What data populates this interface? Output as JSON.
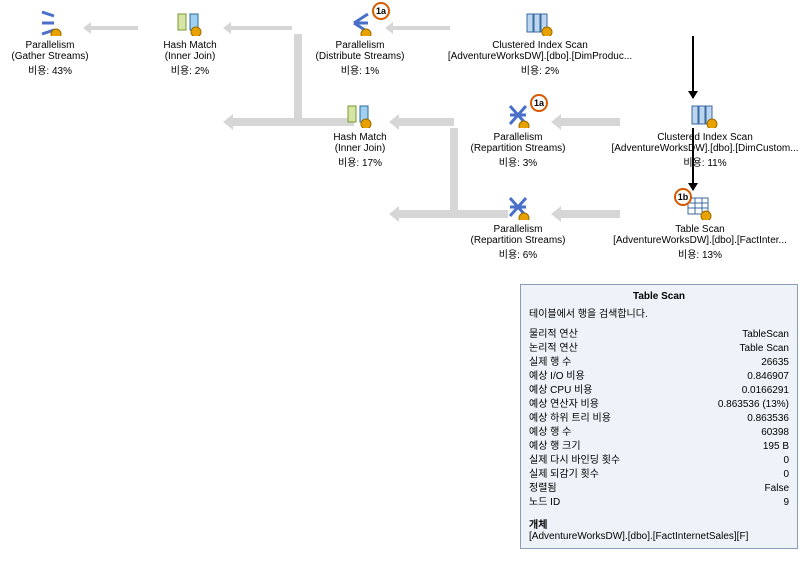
{
  "badges": {
    "a1": "1a",
    "a2": "1a",
    "b": "1b"
  },
  "nodes": {
    "gather": {
      "title": "Parallelism",
      "sub": "(Gather Streams)",
      "cost": "비용: 43%"
    },
    "hash1": {
      "title": "Hash Match",
      "sub": "(Inner Join)",
      "cost": "비용: 2%"
    },
    "dist": {
      "title": "Parallelism",
      "sub": "(Distribute Streams)",
      "cost": "비용: 1%"
    },
    "cis1": {
      "title": "Clustered Index Scan",
      "sub": "[AdventureWorksDW].[dbo].[DimProduc...",
      "cost": "비용: 2%"
    },
    "hash2": {
      "title": "Hash Match",
      "sub": "(Inner Join)",
      "cost": "비용: 17%"
    },
    "repart1": {
      "title": "Parallelism",
      "sub": "(Repartition Streams)",
      "cost": "비용: 3%"
    },
    "cis2": {
      "title": "Clustered Index Scan",
      "sub": "[AdventureWorksDW].[dbo].[DimCustom...",
      "cost": "비용: 11%"
    },
    "repart2": {
      "title": "Parallelism",
      "sub": "(Repartition Streams)",
      "cost": "비용: 6%"
    },
    "tscan": {
      "title": "Table Scan",
      "sub": "[AdventureWorksDW].[dbo].[FactInter...",
      "cost": "비용: 13%"
    }
  },
  "tooltip": {
    "title": "Table Scan",
    "desc": "테이블에서 행을 검색합니다.",
    "rows": [
      {
        "k": "물리적 연산",
        "v": "TableScan"
      },
      {
        "k": "논리적 연산",
        "v": "Table Scan"
      },
      {
        "k": "실제 행 수",
        "v": "26635"
      },
      {
        "k": "예상 I/O 비용",
        "v": "0.846907"
      },
      {
        "k": "예상 CPU 비용",
        "v": "0.0166291"
      },
      {
        "k": "예상 연산자 비용",
        "v": "0.863536 (13%)"
      },
      {
        "k": "예상 하위 트리 비용",
        "v": "0.863536"
      },
      {
        "k": "예상 행 수",
        "v": "60398"
      },
      {
        "k": "예상 행 크기",
        "v": "195 B"
      },
      {
        "k": "실제 다시 바인딩 횟수",
        "v": "0"
      },
      {
        "k": "실제 되감기 횟수",
        "v": "0"
      },
      {
        "k": "정렬됨",
        "v": "False"
      },
      {
        "k": "노드 ID",
        "v": "9"
      }
    ],
    "object_label": "개체",
    "object_value": "[AdventureWorksDW].[dbo].[FactInternetSales][F]"
  }
}
